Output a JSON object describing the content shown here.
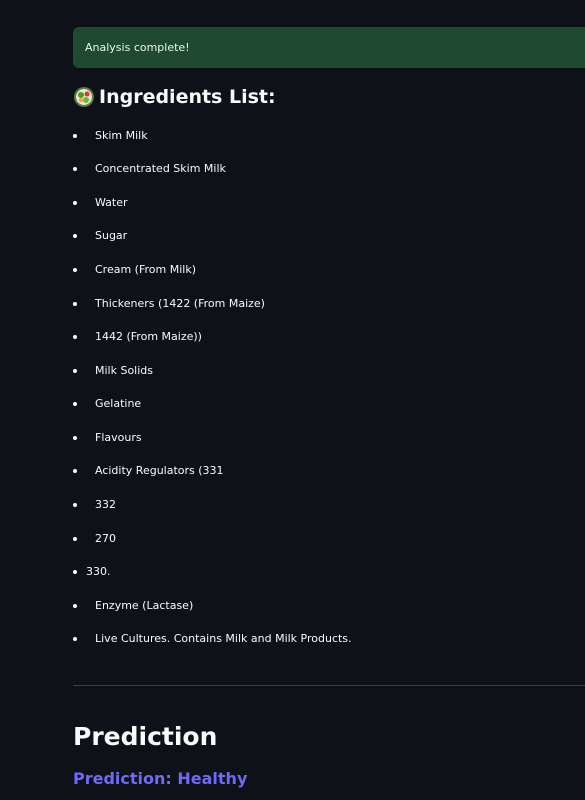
{
  "alert": {
    "message": "Analysis complete!"
  },
  "ingredients_section": {
    "icon": "salad-icon",
    "title": "Ingredients List:",
    "items": [
      "Skim Milk",
      "Concentrated Skim Milk",
      "Water",
      "Sugar",
      "Cream (From Milk)",
      "Thickeners (1422 (From Maize)",
      "1442 (From Maize))",
      "Milk Solids",
      "Gelatine",
      "Flavours",
      "Acidity Regulators (331",
      "332",
      "270",
      "330.",
      "Enzyme (Lactase)",
      "Live Cultures. Contains Milk and Milk Products."
    ]
  },
  "prediction": {
    "heading": "Prediction",
    "result": "Prediction: Healthy"
  },
  "colors": {
    "background": "#0e1117",
    "alert_bg": "#1f4a30",
    "accent": "#6f6af8"
  }
}
